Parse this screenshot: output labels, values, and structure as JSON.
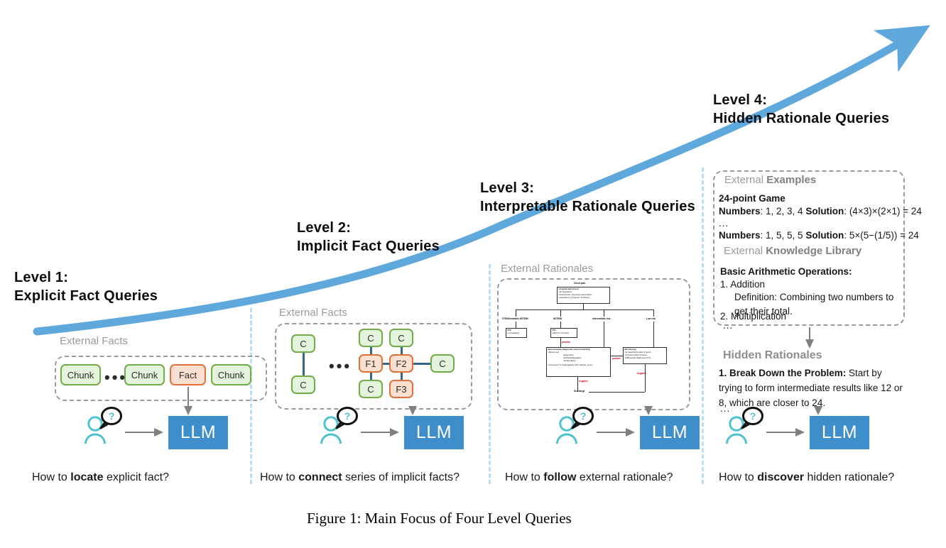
{
  "figure": {
    "caption": "Figure 1: Main Focus of Four Level Queries"
  },
  "levels": [
    {
      "id": 1,
      "title_line1": "Level 1:",
      "title_line2": "Explicit Fact Queries",
      "section_caption_plain": "External Facts",
      "section_caption_bold": "",
      "question_pre": "How to ",
      "question_bold": "locate",
      "question_post": " explicit fact?"
    },
    {
      "id": 2,
      "title_line1": "Level 2:",
      "title_line2": "Implicit Fact Queries",
      "section_caption_plain": "External Facts",
      "section_caption_bold": "",
      "question_pre": "How to ",
      "question_bold": "connect",
      "question_post": " series of implicit facts?"
    },
    {
      "id": 3,
      "title_line1": "Level 3:",
      "title_line2": "Interpretable Rationale Queries",
      "section_caption_plain": "External Rationales",
      "section_caption_bold": "",
      "question_pre": "How to ",
      "question_bold": "follow",
      "question_post": " external rationale?"
    },
    {
      "id": 4,
      "title_line1": "Level 4:",
      "title_line2": "Hidden Rationale Queries",
      "section_caption_plain": "External ",
      "section_caption_bold": "Examples",
      "question_pre": "How to ",
      "question_bold": "discover",
      "question_post": " hidden rationale?"
    }
  ],
  "level1": {
    "pills": [
      {
        "label": "Chunk",
        "kind": "green"
      },
      {
        "label": "Chunk",
        "kind": "green"
      },
      {
        "label": "Fact",
        "kind": "orange"
      },
      {
        "label": "Chunk",
        "kind": "green"
      }
    ],
    "ellipsis": "•••"
  },
  "level2": {
    "left_pair": [
      {
        "label": "C",
        "kind": "green"
      },
      {
        "label": "C",
        "kind": "green"
      }
    ],
    "ellipsis": "•••",
    "graph_nodes": [
      {
        "label": "C",
        "kind": "green"
      },
      {
        "label": "C",
        "kind": "green"
      },
      {
        "label": "F1",
        "kind": "orange"
      },
      {
        "label": "F2",
        "kind": "orange"
      },
      {
        "label": "C",
        "kind": "green"
      },
      {
        "label": "C",
        "kind": "green"
      },
      {
        "label": "F3",
        "kind": "orange"
      }
    ]
  },
  "level3": {
    "flowchart_title": "Chest pain",
    "nodes": {
      "admission_title": "Hospital admission",
      "admission_lines": [
        "•12 lead ECG",
        "•Anamnesis, physical examination",
        "•Laboratory (Troponin, D-Dimer)"
      ],
      "branch_labels": [
        "STEMI/unstable NSTEMI",
        "NSTEMI",
        "Intermediate risk",
        "Low risk"
      ],
      "pci_immediate_title": "PCI",
      "pci_immediate_sub": "immediately",
      "pci_delayed_title": "PCI",
      "pci_delayed_sub": "within 2-72 hours",
      "noninvasive_title": "Non-invasive diagnostic and monitoring",
      "noninvasive_line1": "•Stress test",
      "noninvasive_indented": [
        "Ergometry",
        "Echocardiography",
        "Scintigraphy"
      ],
      "noninvasive_last": "•Coronary CT Angiography with calcium score",
      "monitoring_title": "Monitoring",
      "monitoring_lines": [
        "•12 lead ECG after 6 hours",
        "•Troponin after 6 hours",
        "•Differential diagnosis (CT)"
      ],
      "discharge": "Discharge"
    },
    "edge_labels": {
      "positive": "positive",
      "negative": "negative"
    }
  },
  "level4": {
    "examples_caption_plain": "External ",
    "examples_caption_bold": "Examples",
    "game_title": "24-point Game",
    "example_rows": [
      {
        "numbers_label": "Numbers",
        "numbers": ": 1, 2, 3, 4 ",
        "solution_label": "Solution",
        "solution": ": (4×3)×(2×1) = 24"
      },
      {
        "numbers_label": "Numbers",
        "numbers": ": 1, 5, 5, 5 ",
        "solution_label": "Solution",
        "solution": ": 5×(5−(1/5)) = 24"
      }
    ],
    "ellipsis": "...",
    "library_caption_plain": "External ",
    "library_caption_bold": "Knowledge Library",
    "library_title": "Basic Arithmetic Operations:",
    "library_items": [
      "1. Addition",
      "Definition: Combining two numbers to get their total.",
      "2. Multiplication"
    ],
    "library_ellipsis": "...",
    "hidden_rationales_title": "Hidden Rationales",
    "rationale_bold": "1. Break Down the Problem:",
    "rationale_rest": " Start by trying to form intermediate results like 12 or 8, which are closer to 24.",
    "rationale_ellipsis": "..."
  },
  "shared": {
    "llm_label": "LLM",
    "user_icon": "person-icon",
    "question_bubble": "?"
  },
  "colors": {
    "accent_curve": "#5fa8dc",
    "llm_blue": "#3f8ecc",
    "user_teal": "#4ec3cf",
    "green_fill": "#e4f3db",
    "green_stroke": "#70ad47",
    "orange_fill": "#fbe0d2",
    "orange_stroke": "#e0703a",
    "divider": "#bcdcf0",
    "grey_text": "#9b9b9b",
    "arrow_grey": "#808080",
    "flow_red": "#d0021b"
  }
}
